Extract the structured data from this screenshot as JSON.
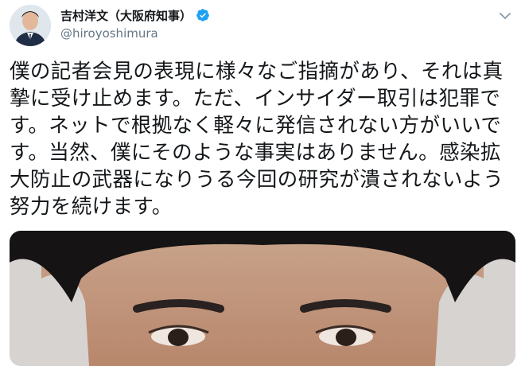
{
  "tweet": {
    "author": {
      "display_name": "吉村洋文（大阪府知事）",
      "handle": "@hiroyoshimura",
      "verified": true
    },
    "text": "僕の記者会見の表現に様々なご指摘があり、それは真摯に受け止めます。ただ、インサイダー取引は犯罪です。ネットで根拠なく軽々に発信されない方がいいです。当然、僕にそのような事実はありません。感染拡大防止の武器になりうる今回の研究が潰されないよう努力を続けます。",
    "menu_icon": "chevron-down-icon"
  },
  "colors": {
    "verified_badge": "#1da1f2",
    "handle": "#657786",
    "text": "#14171a"
  }
}
